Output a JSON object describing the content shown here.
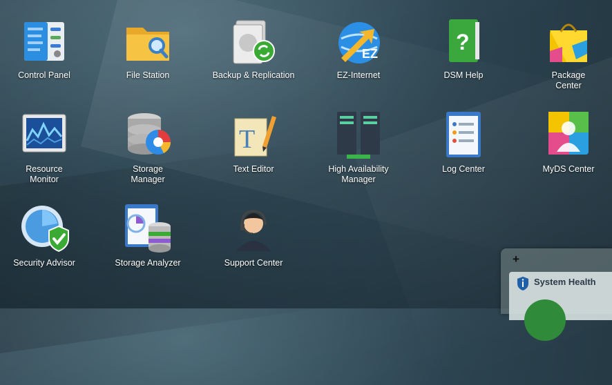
{
  "apps": [
    {
      "id": "control-panel",
      "label": "Control Panel",
      "icon": "control-panel-icon"
    },
    {
      "id": "file-station",
      "label": "File Station",
      "icon": "folder-icon"
    },
    {
      "id": "backup-replication",
      "label": "Backup & Replication",
      "icon": "backup-icon"
    },
    {
      "id": "ez-internet",
      "label": "EZ-Internet",
      "icon": "globe-icon"
    },
    {
      "id": "dsm-help",
      "label": "DSM Help",
      "icon": "help-book-icon"
    },
    {
      "id": "package-center",
      "label": "Package\nCenter",
      "icon": "shopping-bag-icon"
    },
    {
      "id": "resource-monitor",
      "label": "Resource\nMonitor",
      "icon": "monitor-graph-icon"
    },
    {
      "id": "storage-manager",
      "label": "Storage\nManager",
      "icon": "database-pie-icon"
    },
    {
      "id": "text-editor",
      "label": "Text Editor",
      "icon": "text-pencil-icon"
    },
    {
      "id": "high-availability",
      "label": "High Availability\nManager",
      "icon": "servers-icon"
    },
    {
      "id": "log-center",
      "label": "Log Center",
      "icon": "log-list-icon"
    },
    {
      "id": "myds-center",
      "label": "MyDS Center",
      "icon": "user-card-icon"
    },
    {
      "id": "security-advisor",
      "label": "Security Advisor",
      "icon": "shield-radar-icon"
    },
    {
      "id": "storage-analyzer",
      "label": "Storage Analyzer",
      "icon": "report-db-icon"
    },
    {
      "id": "support-center",
      "label": "Support Center",
      "icon": "headset-person-icon"
    }
  ],
  "widget": {
    "add_label": "+",
    "title": "System Health",
    "info_icon": "info-shield-icon"
  },
  "ez_badge": "EZ",
  "help_glyph": "?",
  "text_glyph": "T"
}
